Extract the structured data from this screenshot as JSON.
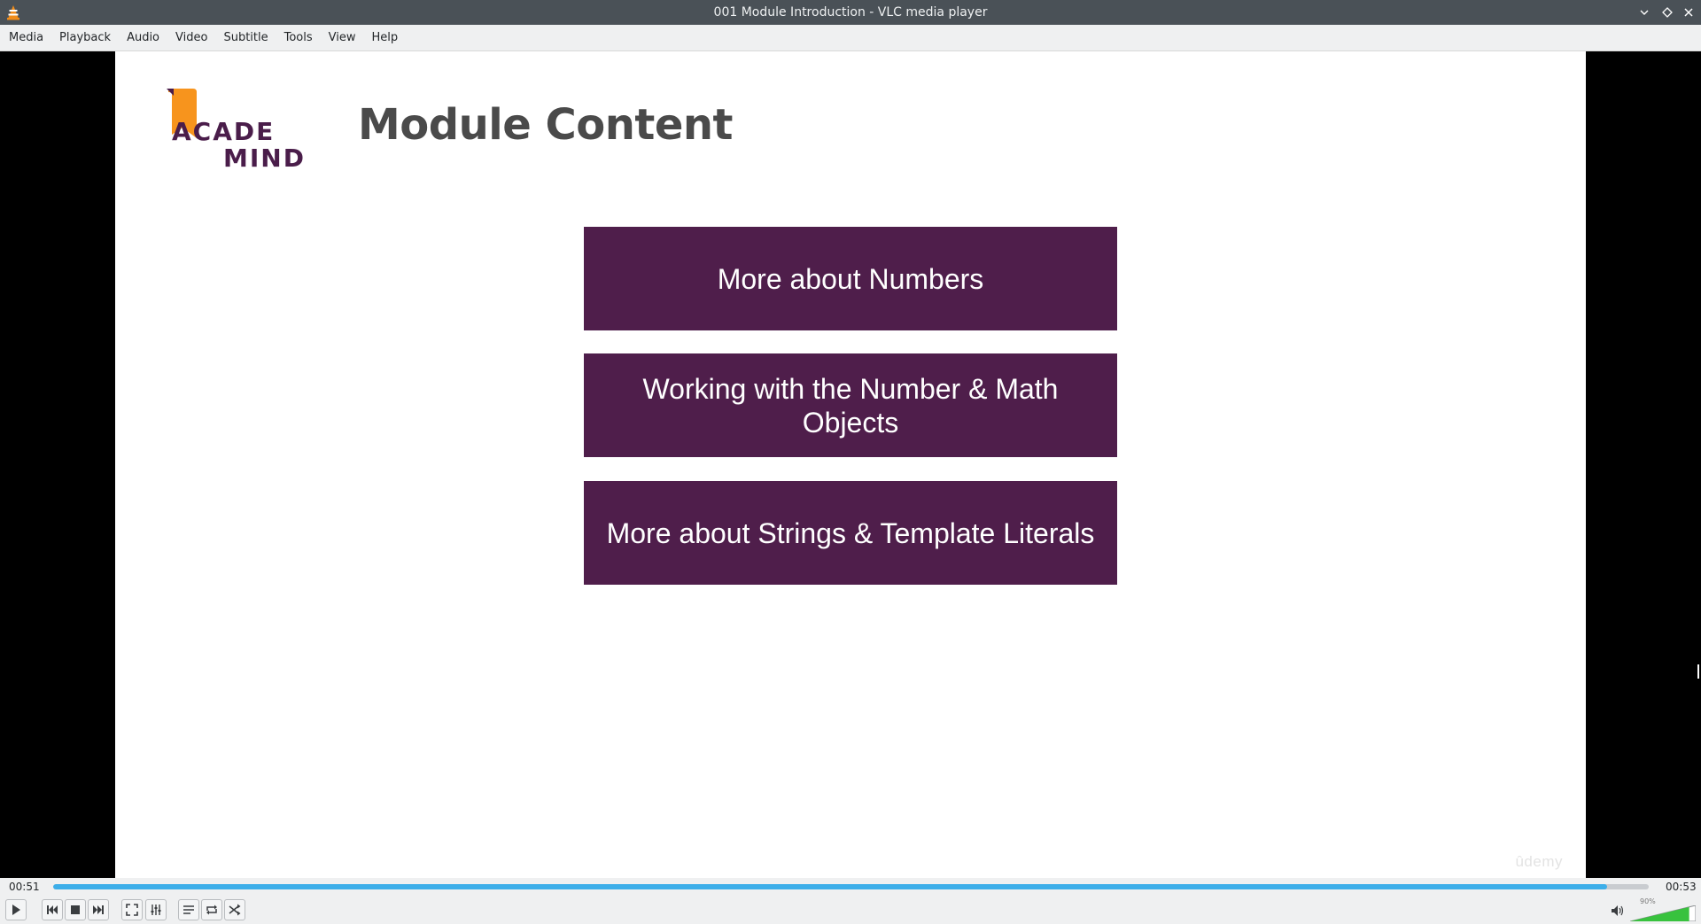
{
  "window": {
    "title": "001 Module Introduction - VLC media player",
    "app_icon": "vlc-cone-icon",
    "buttons": [
      "minimize-chevron-icon",
      "maximize-diamond-icon",
      "close-x-icon"
    ]
  },
  "menubar": {
    "items": [
      "Media",
      "Playback",
      "Audio",
      "Video",
      "Subtitle",
      "Tools",
      "View",
      "Help"
    ]
  },
  "slide": {
    "logo": {
      "line1": "ACADE",
      "line2": "MIND",
      "bookmark_color": "#f7941d",
      "text_color": "#4a1d4a"
    },
    "title": "Module Content",
    "topics": [
      "More about Numbers",
      "Working with the Number & Math Objects",
      "More about Strings & Template Literals"
    ],
    "topic_color": "#4f1e4b",
    "watermark": "ûdemy"
  },
  "playback": {
    "elapsed": "00:51",
    "total": "00:53",
    "progress_fraction": 0.974,
    "accent_color": "#3daee9"
  },
  "controls": {
    "buttons": [
      "play-icon",
      "previous-icon",
      "stop-icon",
      "next-icon",
      "fullscreen-icon",
      "extended-settings-icon",
      "playlist-icon",
      "loop-icon",
      "shuffle-icon"
    ]
  },
  "volume": {
    "label": "90%",
    "level_fraction": 0.9,
    "icon": "speaker-icon"
  }
}
